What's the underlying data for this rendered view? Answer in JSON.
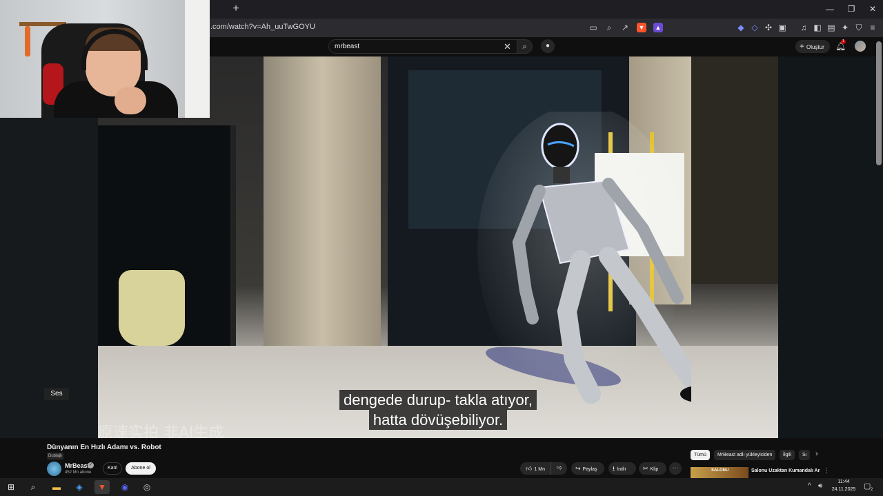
{
  "browser": {
    "url": ".com/watch?v=Ah_uuTwGOYU",
    "new_tab": "+",
    "minimize": "—",
    "restore": "❐",
    "close": "✕"
  },
  "youtube": {
    "search_value": "mrbeast",
    "create_label": "Oluştur",
    "notification_count": "1"
  },
  "video": {
    "caption_lines": [
      "dengede durup- takla atıyor,",
      "hatta dövüşebiliyor."
    ],
    "watermark": "原速实拍   非AI生成",
    "volume_tooltip": "Ses"
  },
  "info": {
    "title": "Dünyanın En Hızlı Adamı vs. Robot",
    "dubbed_badge": "Dublajlı",
    "channel_name": "MrBeast",
    "subscribers": "452 Mn abone",
    "join_label": "Katıl",
    "subscribe_label": "Abone ol",
    "like_count": "1 Mn",
    "share_label": "Paylaş",
    "download_label": "İndir",
    "clip_label": "Klip",
    "more_label": "···"
  },
  "chips": [
    "Tümü",
    "MrBeast adlı yükleyiciden",
    "İlgili",
    "Sı"
  ],
  "recommended": {
    "thumb_text": "SALONU",
    "title": "Salonu Uzaktan Kumandalı Arabe Pistine Çevirdim!"
  },
  "taskbar": {
    "time": "11:44",
    "date": "24.11.2025",
    "notification_count": "2"
  },
  "colors": {
    "accent_red": "#cc0000",
    "brave": "#fb542b"
  }
}
